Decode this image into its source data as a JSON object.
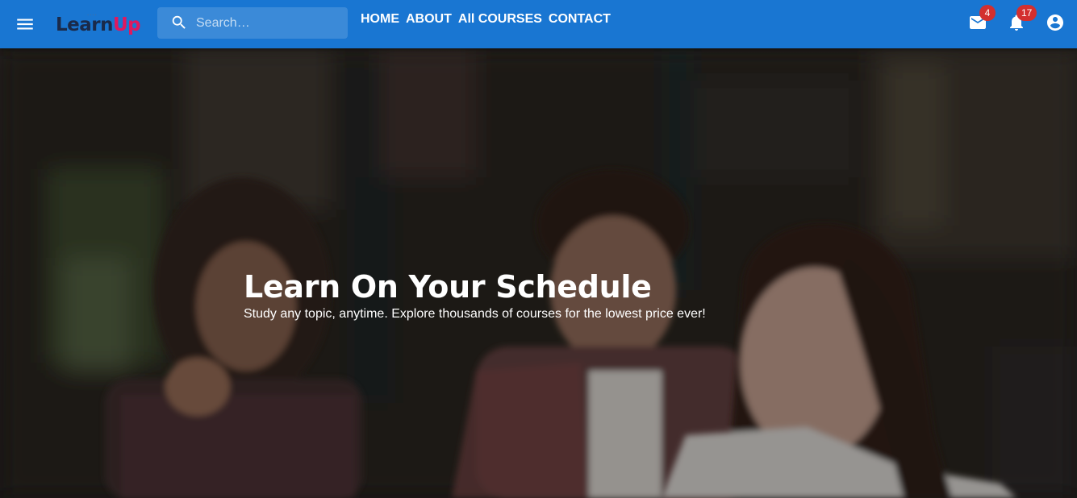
{
  "brand": {
    "logo_dots": "....",
    "logo_learn": "Learn",
    "logo_up": "Up"
  },
  "search": {
    "placeholder": "Search…"
  },
  "nav": {
    "items": [
      "HOME",
      "ABOUT",
      "All COURSES",
      "CONTACT"
    ]
  },
  "actions": {
    "mail_count": "4",
    "notification_count": "17"
  },
  "hero": {
    "title": "Learn On Your Schedule",
    "subtitle": "Study any topic, anytime. Explore thousands of courses for the lowest price ever!"
  },
  "colors": {
    "appbar": "#1976d2",
    "badge": "#d32f2f",
    "logo_accent": "#e0185e",
    "logo_dark": "#1a2a4a"
  },
  "icons": [
    "menu-icon",
    "search-icon",
    "mail-icon",
    "bell-icon",
    "account-circle-icon"
  ]
}
